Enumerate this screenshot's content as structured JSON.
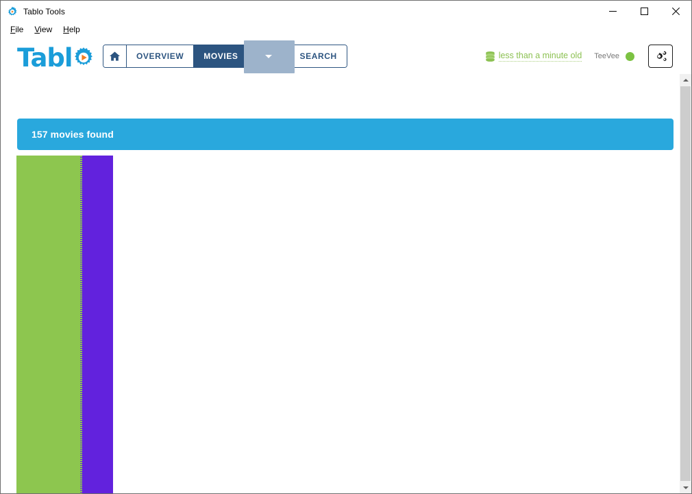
{
  "window": {
    "title": "Tablo Tools",
    "app_icon": "gear-icon",
    "controls": {
      "minimize": "minimize-icon",
      "maximize": "maximize-icon",
      "close": "close-icon"
    }
  },
  "menubar": {
    "items": [
      {
        "label": "File",
        "mnemonic": "F",
        "rest": "ile"
      },
      {
        "label": "View",
        "mnemonic": "V",
        "rest": "iew"
      },
      {
        "label": "Help",
        "mnemonic": "H",
        "rest": "elp"
      }
    ]
  },
  "brand": {
    "text": "Tabl",
    "gear_icon": "gear-play-icon"
  },
  "nav": {
    "home_icon": "home-icon",
    "items": [
      {
        "label": "OVERVIEW",
        "active": false
      },
      {
        "label": "MOVIES",
        "active": true
      },
      {
        "label": "SEARCH",
        "active": false
      }
    ],
    "dropdown_icon": "chevron-down-icon"
  },
  "status": {
    "db_icon": "database-icon",
    "db_age_label": "less than a minute old",
    "device_name": "TeeVee",
    "device_status_color": "#7cc242",
    "settings_icon": "cogs-icon"
  },
  "banner": {
    "text": "157 movies found",
    "color": "#29a8dd"
  },
  "content": {
    "block": {
      "left_color": "#8dc64f",
      "right_color": "#6222dd"
    }
  },
  "scrollbar": {
    "up_icon": "scroll-up-arrow-icon",
    "down_icon": "scroll-down-arrow-icon"
  },
  "colors": {
    "brand_blue": "#1b9dd9",
    "nav_navy": "#2c5480",
    "banner_blue": "#29a8dd",
    "accent_green": "#8cc152",
    "purple": "#6222dd"
  }
}
